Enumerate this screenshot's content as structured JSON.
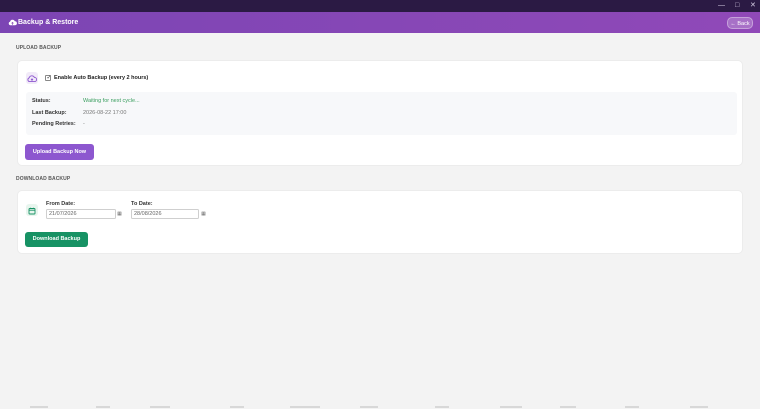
{
  "window": {
    "minimize": "—",
    "maximize": "□",
    "close": "✕"
  },
  "appbar": {
    "title": "Backup & Restore",
    "back_label": "← Back",
    "icon": "cloud-upload-icon"
  },
  "upload": {
    "section_title": "UPLOAD BACKUP",
    "icon": "cloud-upload-icon",
    "accent": "#8d57cf",
    "auto_backup_checked": true,
    "auto_backup_label": "Enable Auto Backup (every 2 hours)",
    "status": {
      "status_label": "Status:",
      "status_value": "Waiting for next cycle...",
      "last_backup_label": "Last Backup:",
      "last_backup_value": "2026-08-22 17:00",
      "pending_label": "Pending Retries:",
      "pending_value": "-"
    },
    "button_label": "Upload Backup Now"
  },
  "download": {
    "section_title": "DOWNLOAD BACKUP",
    "icon": "calendar-icon",
    "accent": "#179264",
    "from_label": "From Date:",
    "from_value": "21/07/2026",
    "to_label": "To Date:",
    "to_value": "28/08/2026",
    "button_label": "Download Backup"
  }
}
